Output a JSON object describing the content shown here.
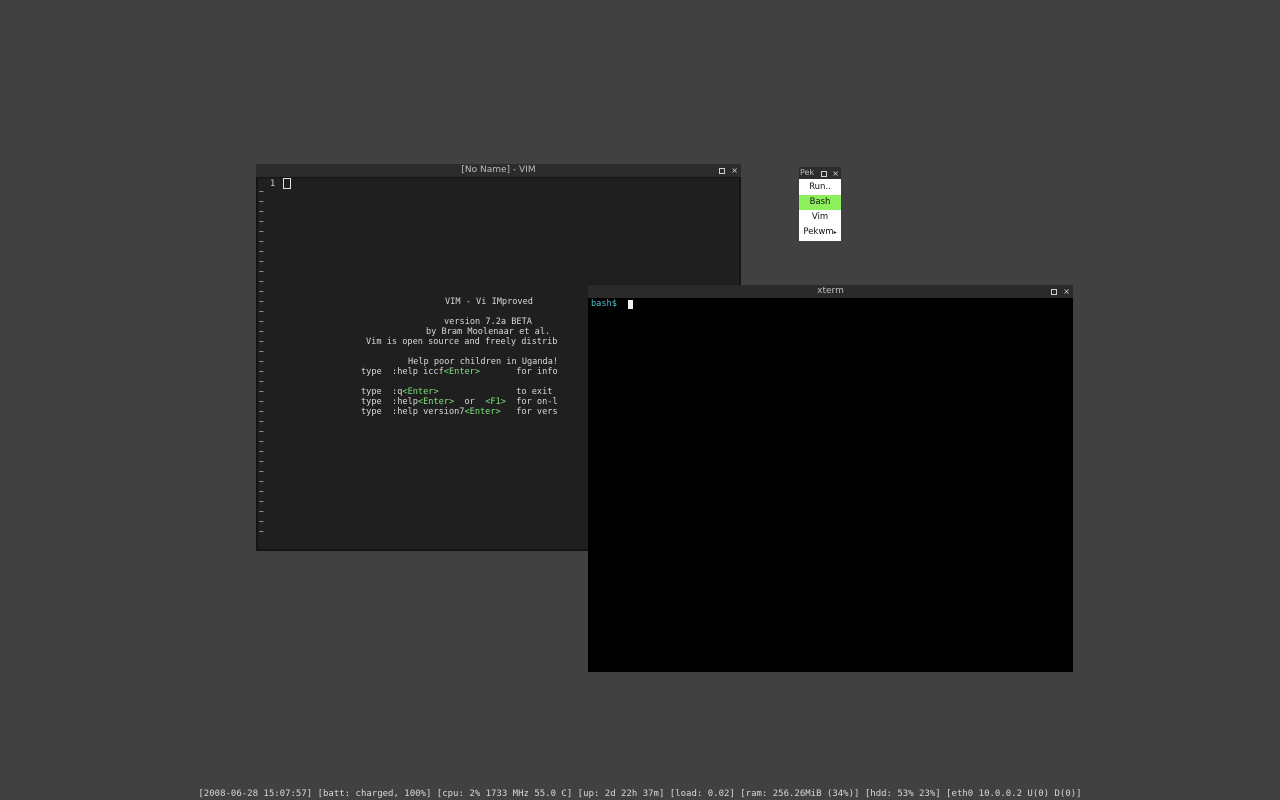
{
  "vim": {
    "title": "[No Name] - VIM",
    "line_number": "1",
    "tilde": "~",
    "intro": {
      "line1": "VIM - Vi IMproved",
      "line2": "version 7.2a BETA",
      "line3": "by Bram Moolenaar et al.",
      "line4": "Vim is open source and freely distrib",
      "line5": "Help poor children in Uganda!",
      "help_iccf": {
        "pre": "type  :help iccf",
        "key": "<Enter>",
        "post": "       for info"
      },
      "quit": {
        "pre": "type  :q",
        "key": "<Enter>",
        "post": "               to exit"
      },
      "help": {
        "pre": "type  :help",
        "key": "<Enter>",
        "mid": "  or  ",
        "key2": "<F1>",
        "post": "  for on-l"
      },
      "version": {
        "pre": "type  :help version7",
        "key": "<Enter>",
        "post": "   for vers"
      }
    }
  },
  "menu": {
    "title": "Pek",
    "items": [
      "Run..",
      "Bash",
      "Vim",
      "Pekwm"
    ],
    "selected": "Bash",
    "selected_color": "#8cf05c"
  },
  "xterm": {
    "title": "xterm",
    "prompt": "bash$ "
  },
  "statusbar": {
    "text": "[2008-06-28 15:07:57] [batt: charged, 100%] [cpu: 2% 1733 MHz 55.0 C] [up: 2d 22h 37m] [load: 0.02] [ram: 256.26MiB (34%)] [hdd: 53% 23%] [eth0 10.0.0.2 U(0) D(0)]"
  },
  "icons": {
    "maximize": "maximize-icon",
    "close": "close-icon",
    "close_glyph": "×"
  },
  "colors": {
    "desktop": "#414141",
    "vim_key": "#7fe07f",
    "prompt": "#4fc1c9"
  }
}
